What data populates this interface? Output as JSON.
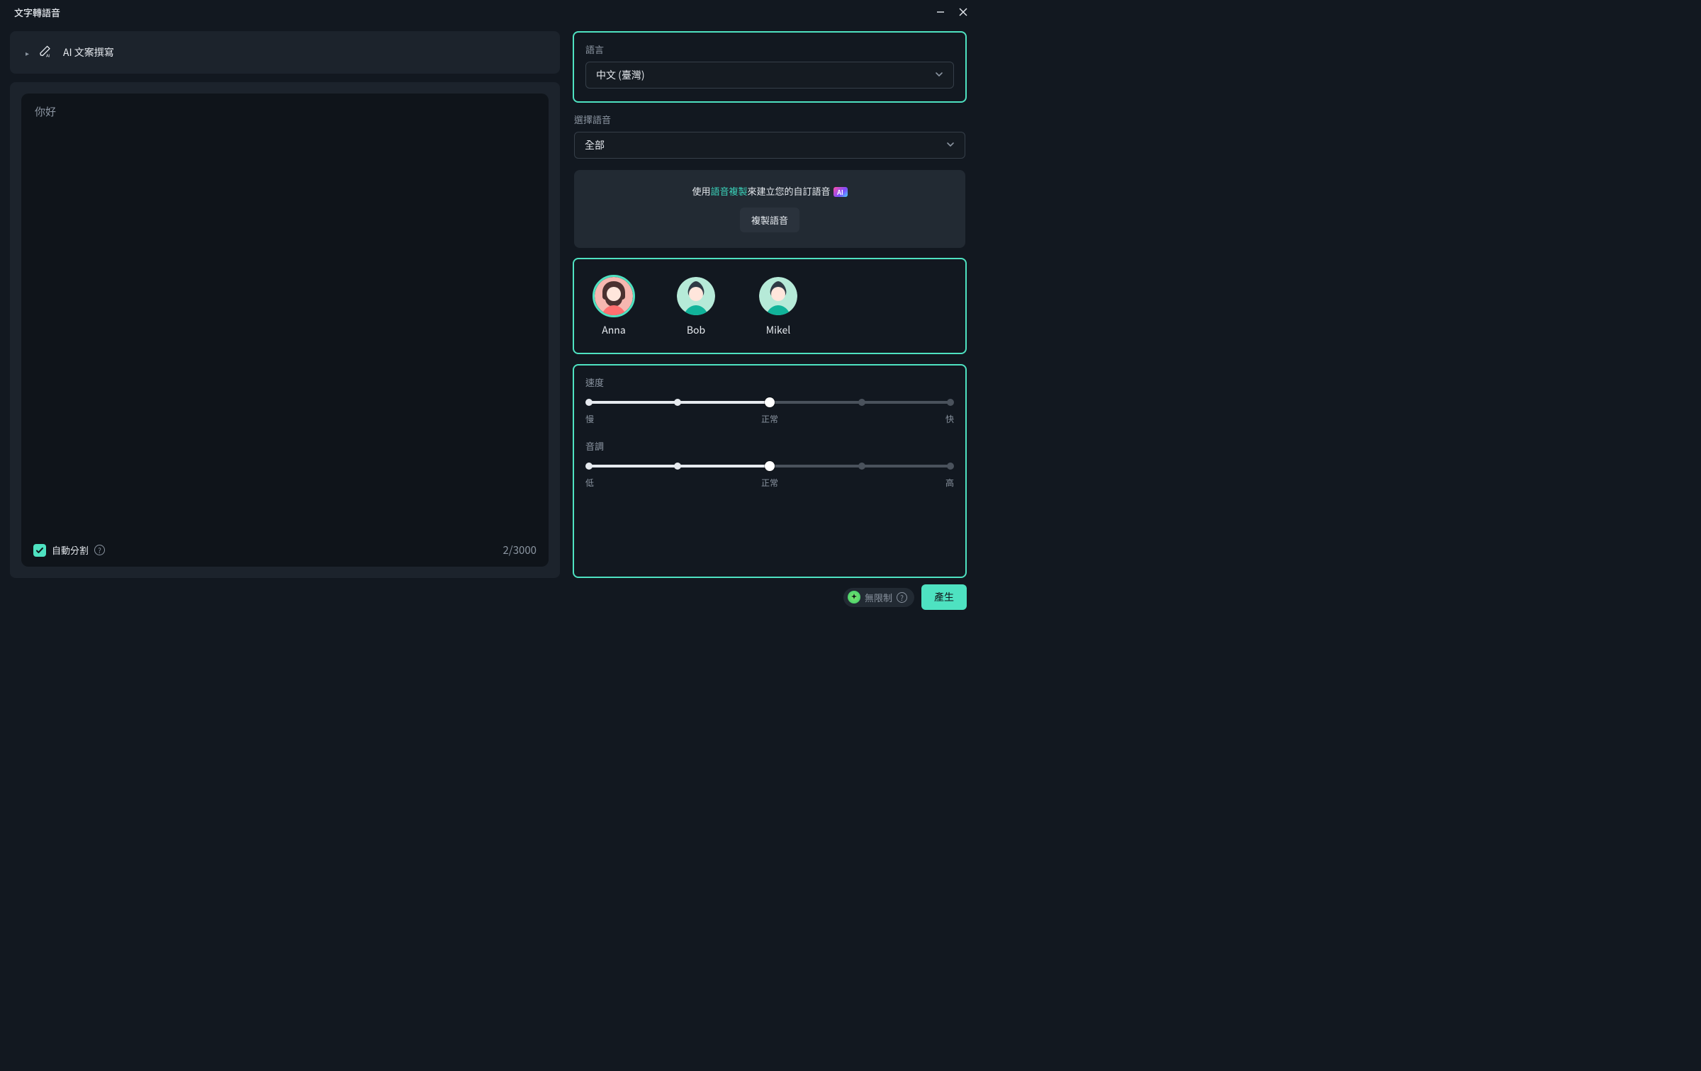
{
  "title": "文字轉語音",
  "ai_row": {
    "label": "AI 文案撰寫"
  },
  "editor": {
    "text": "你好",
    "auto_split_label": "自動分割",
    "auto_split_checked": true,
    "count_current": 2,
    "count_max": 3000,
    "count_display": "2/3000"
  },
  "language": {
    "label": "語言",
    "value": "中文 (臺灣)"
  },
  "voice_filter": {
    "label": "選擇語音",
    "value": "全部"
  },
  "clone": {
    "prefix": "使用",
    "link": "語音複製",
    "suffix": "來建立您的自訂語音",
    "badge": "AI",
    "button": "複製語音"
  },
  "voices": [
    {
      "name": "Anna",
      "selected": true,
      "gender": "female"
    },
    {
      "name": "Bob",
      "selected": false,
      "gender": "male"
    },
    {
      "name": "Mikel",
      "selected": false,
      "gender": "male"
    }
  ],
  "speed": {
    "label": "速度",
    "min_label": "慢",
    "mid_label": "正常",
    "max_label": "快",
    "value_percent": 50
  },
  "pitch": {
    "label": "音調",
    "min_label": "低",
    "mid_label": "正常",
    "max_label": "高",
    "value_percent": 50
  },
  "footer": {
    "unlimited": "無限制",
    "generate": "產生"
  }
}
